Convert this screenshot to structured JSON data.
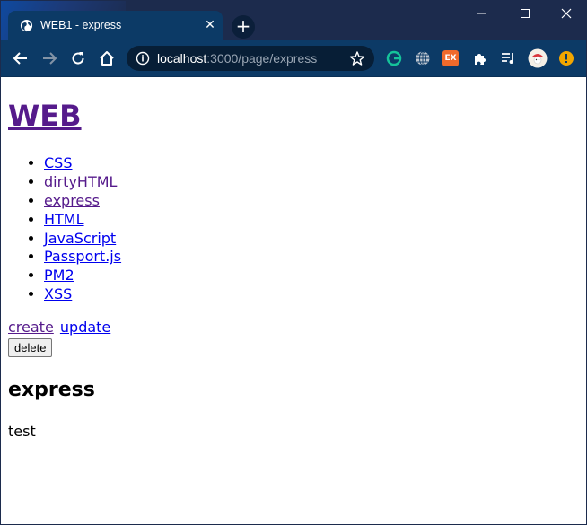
{
  "browser": {
    "tab_title": "WEB1 - express",
    "tab_close_glyph": "✕",
    "new_tab_glyph": "+",
    "url_host": "localhost",
    "url_path": ":3000/page/express",
    "ext_ex_label": "EX",
    "colors": {
      "titlebar": "#1c2b4d",
      "toolbar": "#0c3a66",
      "omnibox": "#071e36"
    }
  },
  "page": {
    "site_title": "WEB",
    "topics": [
      {
        "label": "CSS"
      },
      {
        "label": "dirtyHTML"
      },
      {
        "label": "express"
      },
      {
        "label": "HTML"
      },
      {
        "label": "JavaScript"
      },
      {
        "label": "Passport.js"
      },
      {
        "label": "PM2"
      },
      {
        "label": "XSS"
      }
    ],
    "create_label": "create",
    "update_label": "update",
    "delete_label": "delete",
    "heading": "express",
    "body": "test",
    "colors": {
      "link": "#0000ee",
      "visited_link": "#551a8b"
    }
  }
}
